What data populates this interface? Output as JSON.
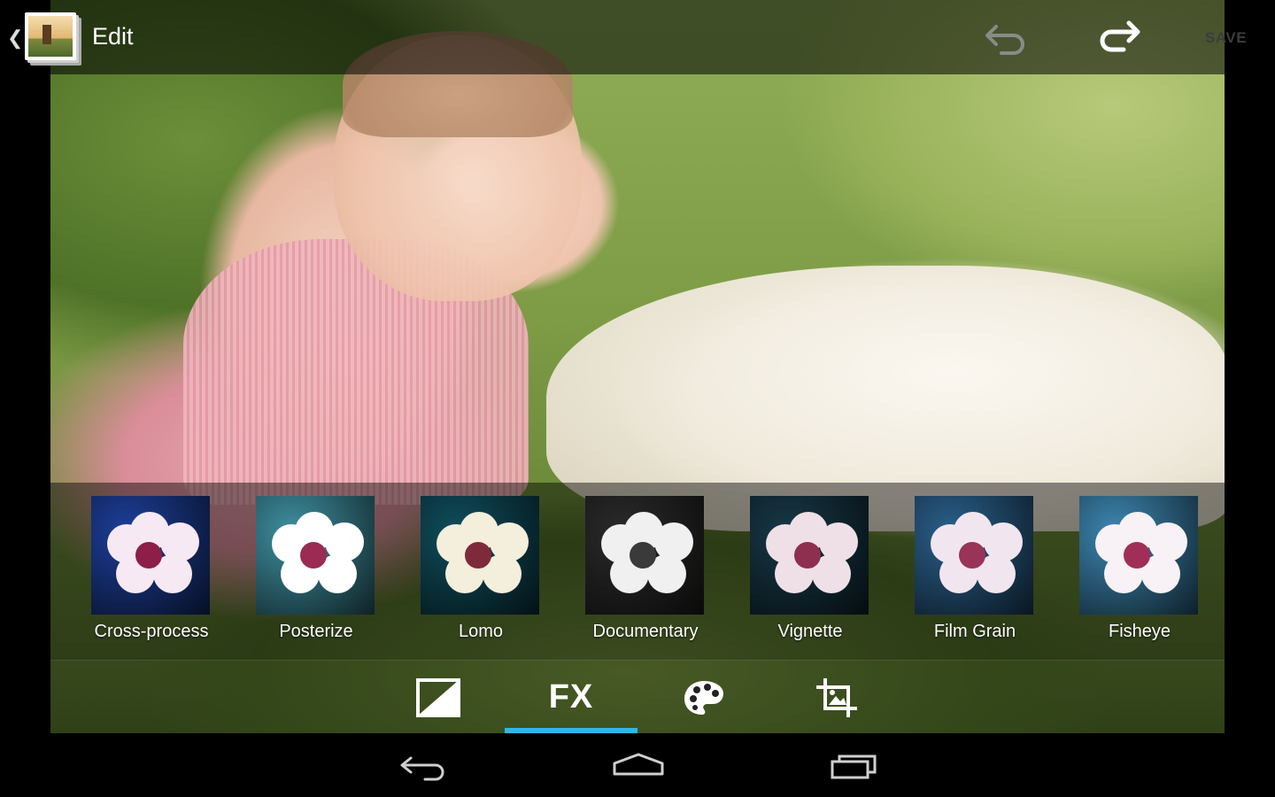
{
  "actionbar": {
    "title": "Edit",
    "save_label": "SAVE",
    "icons": {
      "up": "chevron-left-icon",
      "app": "gallery-app-icon",
      "undo": "undo-icon",
      "redo": "redo-icon"
    }
  },
  "effects": [
    {
      "label": "Cross-process",
      "tint": "#1d3f9a",
      "petal": "#f7e9f3",
      "center": "#8d1e48"
    },
    {
      "label": "Posterize",
      "tint": "#3f8fa0",
      "petal": "#ffffff",
      "center": "#9b2b52"
    },
    {
      "label": "Lomo",
      "tint": "#0f4d5c",
      "petal": "#f4eedc",
      "center": "#7e2a3b"
    },
    {
      "label": "Documentary",
      "tint": "#2a2a2a",
      "petal": "#f0f0f0",
      "center": "#3a3a3a"
    },
    {
      "label": "Vignette",
      "tint": "#173746",
      "petal": "#efe0e7",
      "center": "#8f2f4f"
    },
    {
      "label": "Film Grain",
      "tint": "#2a5f8a",
      "petal": "#f1e6ef",
      "center": "#9a3358"
    },
    {
      "label": "Fisheye",
      "tint": "#3d86b1",
      "petal": "#f8f1f5",
      "center": "#a12e56"
    }
  ],
  "tabs": [
    {
      "name": "exposure",
      "icon": "exposure-icon",
      "selected": false
    },
    {
      "name": "fx",
      "label": "FX",
      "selected": true
    },
    {
      "name": "color",
      "icon": "palette-icon",
      "selected": false
    },
    {
      "name": "crop",
      "icon": "crop-icon",
      "selected": false
    }
  ],
  "colors": {
    "accent": "#33b5e5"
  },
  "navbar": {
    "icons": [
      "back-icon",
      "home-icon",
      "recent-apps-icon"
    ]
  }
}
